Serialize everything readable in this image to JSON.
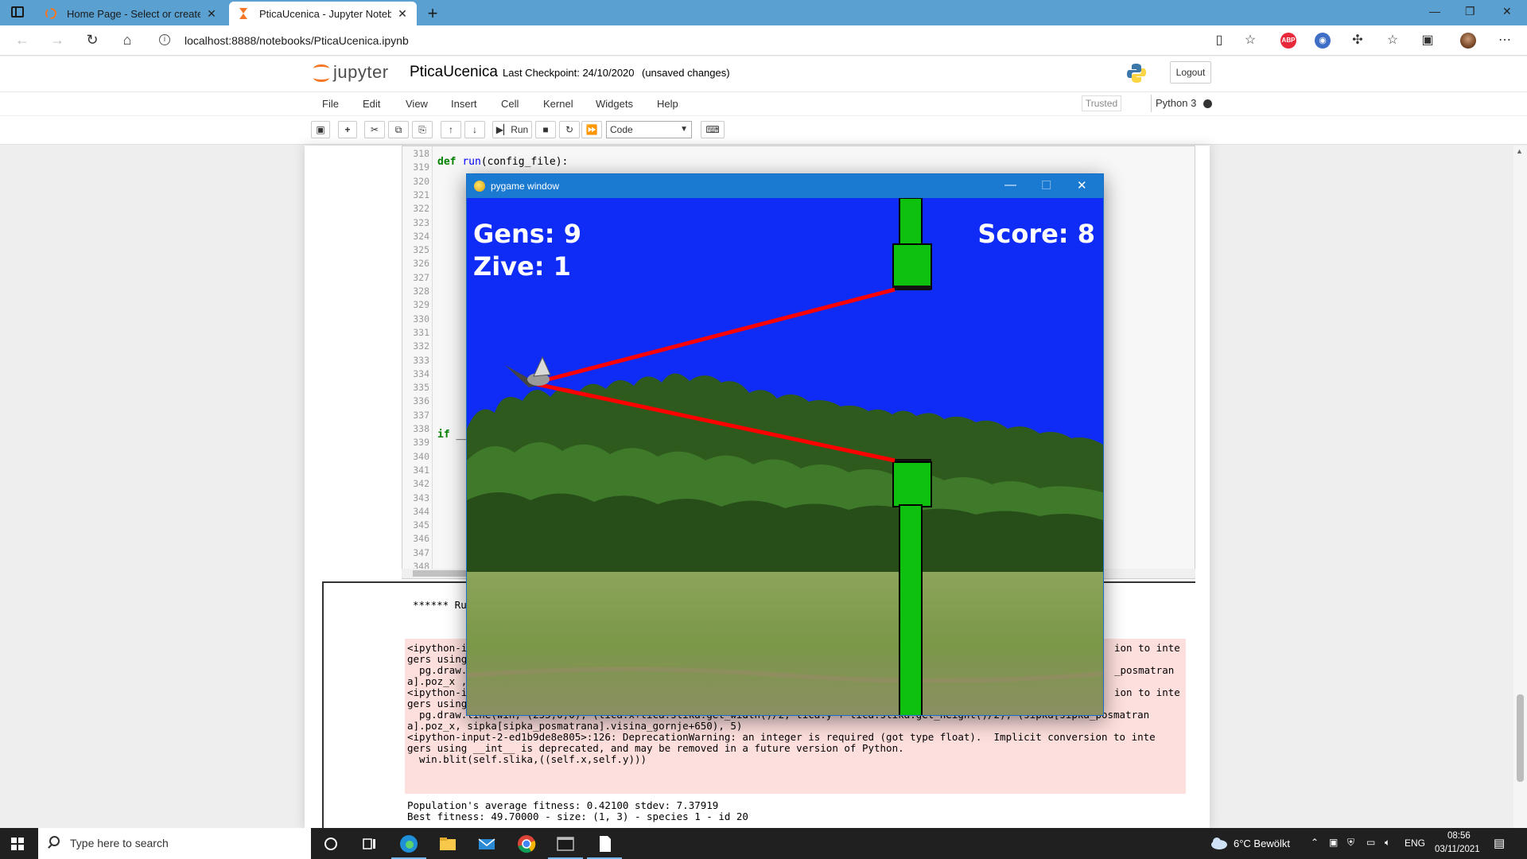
{
  "browser": {
    "tabs": [
      {
        "title": "Home Page - Select or create a n",
        "close": "✕"
      },
      {
        "title": "PticaUcenica - Jupyter Notebook",
        "close": "✕"
      }
    ],
    "new_tab": "+",
    "url": "localhost:8888/notebooks/PticaUcenica.ipynb",
    "window_controls": {
      "minimize": "—",
      "maximize": "❐",
      "close": "✕"
    }
  },
  "jupyter": {
    "logo_text": "jupyter",
    "notebook_name": "PticaUcenica",
    "checkpoint": "Last Checkpoint: 24/10/2020",
    "unsaved": "(unsaved changes)",
    "logout": "Logout",
    "menu": [
      "File",
      "Edit",
      "View",
      "Insert",
      "Cell",
      "Kernel",
      "Widgets",
      "Help"
    ],
    "trusted": "Trusted",
    "kernel": "Python 3",
    "toolbar": {
      "run": "Run",
      "cell_type": "Code"
    }
  },
  "code": {
    "line_numbers": [
      "318",
      "319",
      "320",
      "321",
      "322",
      "323",
      "324",
      "325",
      "326",
      "327",
      "328",
      "329",
      "330",
      "331",
      "332",
      "333",
      "334",
      "335",
      "336",
      "337",
      "338",
      "339",
      "340",
      "341",
      "342",
      "343",
      "344",
      "345",
      "346",
      "347",
      "348"
    ],
    "def_kw": "def",
    "def_fn": "run",
    "def_rest": "(config_file):",
    "if_kw": "if",
    "if_rest": " __"
  },
  "output": {
    "run_header": "****** Ru",
    "stderr_lines": [
      "<ipython-i",
      "gers using",
      "  pg.draw.",
      "a].poz_x ,",
      "<ipython-i",
      "gers using",
      "  pg.draw.line(win, (255,0,0), (tica.x+tica.slika.get_width()/2, tica.y + tica.slika.get_height()/2), (sipka[sipka_posmatran",
      "a].poz_x, sipka[sipka_posmatrana].visina_gornje+650), 5)",
      "<ipython-input-2-ed1b9de8e805>:126: DeprecationWarning: an integer is required (got type float).  Implicit conversion to inte",
      "gers using __int__ is deprecated, and may be removed in a future version of Python.",
      "  win.blit(self.slika,((self.x,self.y)))"
    ],
    "stderr_right": [
      "ion to inte",
      "_posmatran",
      "ion to inte"
    ],
    "stdout_lines": [
      "Population's average fitness: 0.42100 stdev: 7.37919",
      "Best fitness: 49.70000 - size: (1, 3) - species 1 - id 20"
    ]
  },
  "pygame": {
    "title": "pygame window",
    "gens": "Gens: 9",
    "zive": "Zive: 1",
    "score": "Score: 8",
    "colors": {
      "sky": "#0f2bf6",
      "pipe": "#0ec10e",
      "line": "#ff0000"
    }
  },
  "taskbar": {
    "search_placeholder": "Type here to search",
    "weather": "6°C  Bewölkt",
    "lang": "ENG",
    "time": "08:56",
    "date": "03/11/2021"
  }
}
